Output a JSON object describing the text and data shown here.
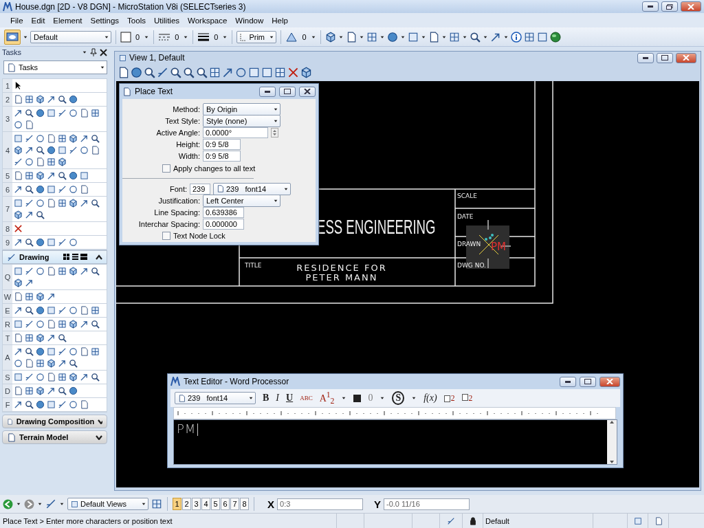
{
  "window": {
    "title": "House.dgn [2D - V8 DGN] - MicroStation V8i (SELECTseries 3)"
  },
  "menu": [
    "File",
    "Edit",
    "Element",
    "Settings",
    "Tools",
    "Utilities",
    "Workspace",
    "Window",
    "Help"
  ],
  "attributes": {
    "level": "Default",
    "color_number": "0",
    "line_code": "0",
    "line_weight": "0",
    "class": "Prim",
    "transparency": "0"
  },
  "tasks": {
    "title": "Tasks",
    "selector": "Tasks",
    "groups": [
      "1",
      "2",
      "3",
      "4",
      "5",
      "6",
      "7",
      "8",
      "9"
    ],
    "sections": [
      {
        "label": "Drawing",
        "expanded": true,
        "groups": [
          "Q",
          "W",
          "E",
          "R",
          "T",
          "A",
          "S",
          "D",
          "F"
        ]
      },
      {
        "label": "Drawing Composition",
        "expanded": false
      },
      {
        "label": "Terrain Model",
        "expanded": false
      }
    ]
  },
  "view": {
    "title": "View 1, Default",
    "drawing": {
      "company": "ESS ENGINEERING",
      "scale": "SCALE",
      "date": "DATE",
      "drawn": "DRAWN",
      "title_label": "TITLE",
      "title_lines": [
        "RESIDENCE FOR",
        "PETER MANN"
      ],
      "dwg_no": "DWG NO.",
      "placed": "PM"
    }
  },
  "place_text": {
    "title": "Place Text",
    "fields": [
      {
        "label": "Method:",
        "kind": "dropdown",
        "value": "By Origin"
      },
      {
        "label": "Text Style:",
        "kind": "dropdown",
        "value": "Style (none)"
      },
      {
        "label": "Active Angle:",
        "kind": "spin",
        "value": "0.0000°"
      },
      {
        "label": "Height:",
        "kind": "text",
        "value": "0:9 5/8"
      },
      {
        "label": "Width:",
        "kind": "text",
        "value": "0:9 5/8"
      }
    ],
    "apply": {
      "label": "Apply changes to all text",
      "checked": false
    },
    "font": {
      "label": "Font:",
      "number": "239",
      "list_number": "239",
      "list_name": "font14"
    },
    "fields2": [
      {
        "label": "Justification:",
        "kind": "dropdown",
        "value": "Left Center"
      },
      {
        "label": "Line Spacing:",
        "kind": "text",
        "value": "0.639386"
      },
      {
        "label": "Interchar Spacing:",
        "kind": "text",
        "value": "0.000000"
      }
    ],
    "node_lock": {
      "label": "Text Node Lock",
      "checked": false
    }
  },
  "text_editor": {
    "title": "Text Editor - Word Processor",
    "font_number": "239",
    "font_name": "font14",
    "tools": [
      {
        "kind": "bold",
        "label": "B"
      },
      {
        "kind": "italic",
        "label": "I"
      },
      {
        "kind": "underline",
        "label": "U"
      },
      {
        "kind": "spell",
        "label": "ABC"
      },
      {
        "kind": "fraction",
        "label": "A$^{1}$$_{2}$"
      },
      {
        "kind": "color"
      },
      {
        "kind": "size",
        "label": "0"
      },
      {
        "kind": "symbol",
        "label": "S"
      },
      {
        "kind": "function",
        "label": "f(x)"
      },
      {
        "kind": "superscript",
        "label": "2"
      },
      {
        "kind": "subscript",
        "label": "2"
      }
    ],
    "content": "PM"
  },
  "views": {
    "saved": "Default Views",
    "buttons": [
      {
        "label": "1",
        "selected": true
      },
      {
        "label": "2",
        "selected": false
      },
      {
        "label": "3",
        "selected": false
      },
      {
        "label": "4",
        "selected": false
      },
      {
        "label": "5",
        "selected": false
      },
      {
        "label": "6",
        "selected": false
      },
      {
        "label": "7",
        "selected": false
      },
      {
        "label": "8",
        "selected": false
      }
    ]
  },
  "coords": [
    {
      "axis": "X",
      "value": "0:3"
    },
    {
      "axis": "Y",
      "value": "-0.0 11/16"
    }
  ],
  "status": {
    "prompt": "Place Text > Enter more characters or position text",
    "level": "Default"
  }
}
